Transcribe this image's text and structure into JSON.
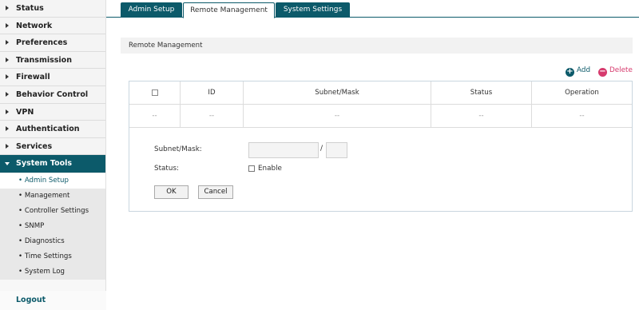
{
  "sidebar": {
    "items": [
      {
        "label": "Status"
      },
      {
        "label": "Network"
      },
      {
        "label": "Preferences"
      },
      {
        "label": "Transmission"
      },
      {
        "label": "Firewall"
      },
      {
        "label": "Behavior Control"
      },
      {
        "label": "VPN"
      },
      {
        "label": "Authentication"
      },
      {
        "label": "Services"
      },
      {
        "label": "System Tools"
      }
    ],
    "subitems": [
      {
        "label": "Admin Setup"
      },
      {
        "label": "Management"
      },
      {
        "label": "Controller Settings"
      },
      {
        "label": "SNMP"
      },
      {
        "label": "Diagnostics"
      },
      {
        "label": "Time Settings"
      },
      {
        "label": "System Log"
      }
    ],
    "logout": "Logout"
  },
  "tabs": [
    {
      "label": "Admin Setup"
    },
    {
      "label": "Remote Management"
    },
    {
      "label": "System Settings"
    }
  ],
  "section": {
    "title": "Remote Management"
  },
  "actions": {
    "add": "Add",
    "delete": "Delete"
  },
  "table": {
    "headers": [
      "ID",
      "Subnet/Mask",
      "Status",
      "Operation"
    ],
    "empty_row": [
      "--",
      "--",
      "--",
      "--",
      "--"
    ]
  },
  "form": {
    "subnet_label": "Subnet/Mask:",
    "slash": "/",
    "status_label": "Status:",
    "enable_label": "Enable",
    "ok": "OK",
    "cancel": "Cancel"
  },
  "colors": {
    "primary": "#0c5a6a",
    "delete": "#d63a6d"
  }
}
